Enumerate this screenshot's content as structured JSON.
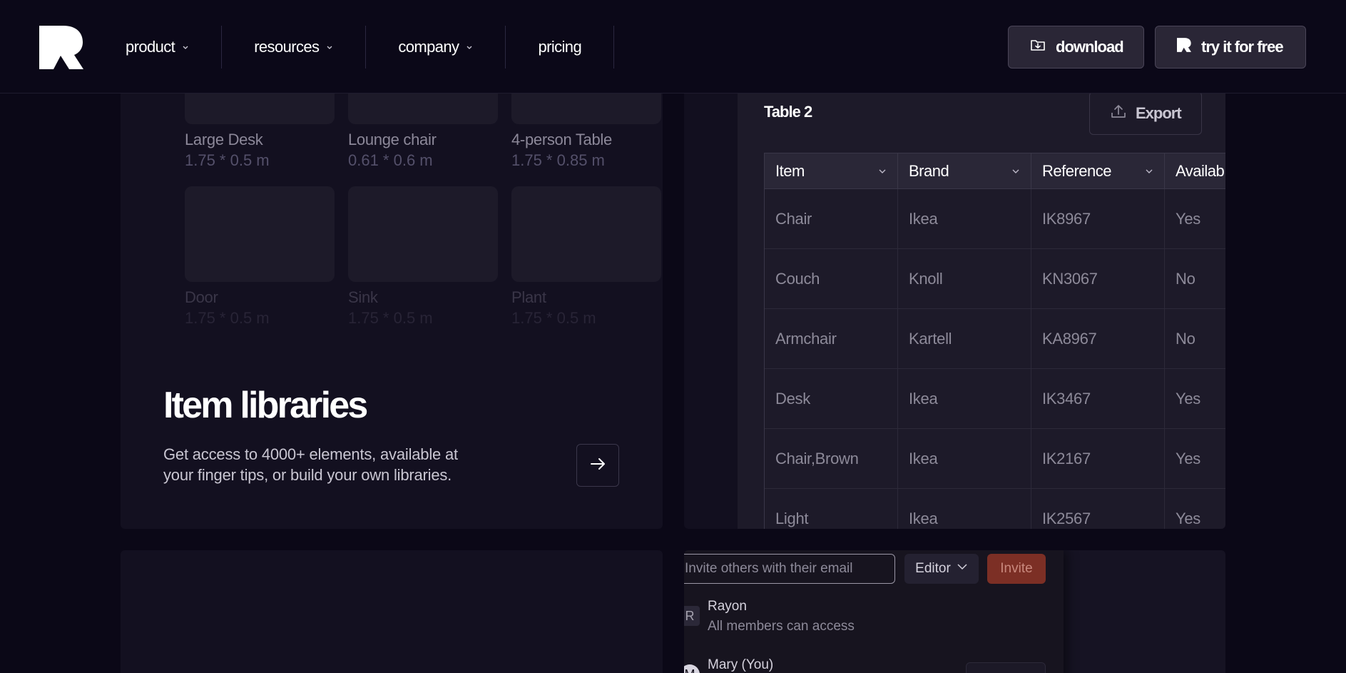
{
  "nav": {
    "items": [
      {
        "label": "product"
      },
      {
        "label": "resources"
      },
      {
        "label": "company"
      },
      {
        "label": "pricing"
      }
    ],
    "download_label": "download",
    "try_label": "try it for free"
  },
  "library": {
    "tiles": [
      {
        "name": "Large Desk",
        "dims": "1.75 * 0.5 m"
      },
      {
        "name": "Lounge chair",
        "dims": "0.61 * 0.6 m"
      },
      {
        "name": "4-person Table",
        "dims": "1.75 * 0.85 m"
      },
      {
        "name": "Door",
        "dims": "1.75 * 0.5 m"
      },
      {
        "name": "Sink",
        "dims": "1.75 * 0.5 m"
      },
      {
        "name": "Plant",
        "dims": "1.75 * 0.5 m"
      }
    ],
    "title": "Item libraries",
    "description": "Get access to 4000+ elements, available at your finger tips, or build your own libraries."
  },
  "table_panel": {
    "title": "Table 2",
    "export_label": "Export",
    "columns": [
      "Item",
      "Brand",
      "Reference",
      "Availab"
    ],
    "rows": [
      [
        "Chair",
        "Ikea",
        "IK8967",
        "Yes"
      ],
      [
        "Couch",
        "Knoll",
        "KN3067",
        "No"
      ],
      [
        "Armchair",
        "Kartell",
        "KA8967",
        "No"
      ],
      [
        "Desk",
        "Ikea",
        "IK3467",
        "Yes"
      ],
      [
        "Chair,Brown",
        "Ikea",
        "IK2167",
        "Yes"
      ],
      [
        "Light",
        "Ikea",
        "IK2567",
        "Yes"
      ]
    ]
  },
  "invite": {
    "placeholder": "Invite others with their email",
    "role": "Editor",
    "invite_label": "Invite",
    "members": [
      {
        "initial": "R",
        "name": "Rayon",
        "sub": "All members can access"
      },
      {
        "initial": "M",
        "name": "Mary (You)",
        "sub": ""
      }
    ]
  },
  "colors": {
    "background": "#0b0817",
    "card": "#131020",
    "invite_accent": "#7c2f25"
  }
}
